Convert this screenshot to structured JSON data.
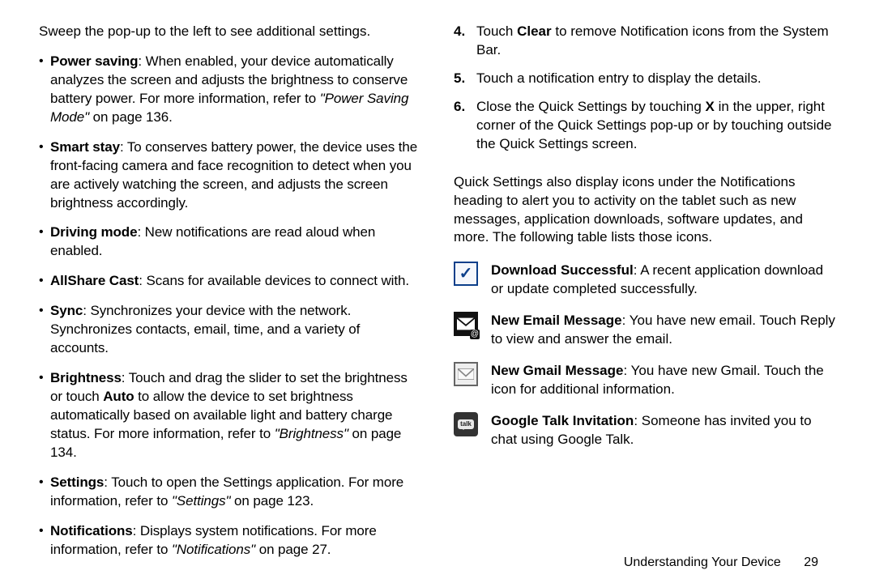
{
  "left": {
    "intro": "Sweep the pop-up to the left to see additional settings.",
    "items": [
      {
        "term": "Power saving",
        "body": ": When enabled, your device automatically analyzes the screen and adjusts the brightness to conserve battery power. For more information, refer to ",
        "ref": "\"Power Saving Mode\"",
        "tail": " on page 136."
      },
      {
        "term": "Smart stay",
        "body": ": To conserves battery power, the device uses the front-facing camera and face recognition to detect when you are actively watching the screen, and adjusts the screen brightness accordingly."
      },
      {
        "term": "Driving mode",
        "body": ": New notifications are read aloud when enabled."
      },
      {
        "term": "AllShare Cast",
        "body": ": Scans for available devices to connect with."
      },
      {
        "term": "Sync",
        "body": ": Synchronizes your device with the network. Synchronizes contacts, email, time, and a variety of accounts."
      },
      {
        "term": "Brightness",
        "body": ": Touch and drag the slider to set the brightness or touch ",
        "bold_mid": "Auto",
        "body2": " to allow the device to set brightness automatically based on available light and battery charge status. For more information, refer to ",
        "ref": "\"Brightness\"",
        "tail": " on page 134."
      },
      {
        "term": "Settings",
        "body": ": Touch to open the Settings application. For more information, refer to ",
        "ref": "\"Settings\"",
        "tail": " on page 123."
      },
      {
        "term": "Notifications",
        "body": ": Displays system notifications. For more information, refer to ",
        "ref": "\"Notifications\"",
        "tail": " on page 27."
      }
    ]
  },
  "right": {
    "steps": [
      {
        "pre": "Touch ",
        "bold": "Clear",
        "post": " to remove Notification icons from the System Bar."
      },
      {
        "pre": "Touch a notification entry to display the details."
      },
      {
        "pre": "Close the Quick Settings by touching ",
        "bold": "X",
        "post": " in the upper, right corner of the Quick Settings pop-up or by touching outside the Quick Settings screen."
      }
    ],
    "para": "Quick Settings also display icons under the Notifications heading to alert you to activity on the tablet such as new messages, application downloads, software updates, and more. The following table lists those icons.",
    "icons": [
      {
        "name": "download-success-icon",
        "term": "Download Successful",
        "desc": ": A recent application download or update completed successfully."
      },
      {
        "name": "new-email-icon",
        "term": "New Email Message",
        "desc": ": You have new email. Touch Reply to view and answer the email."
      },
      {
        "name": "new-gmail-icon",
        "term": "New Gmail Message",
        "desc": ": You have new Gmail. Touch the icon for additional information."
      },
      {
        "name": "google-talk-icon",
        "term": "Google Talk Invitation",
        "desc": ": Someone has invited you to chat using Google Talk."
      }
    ]
  },
  "footer": {
    "section": "Understanding Your Device",
    "page": "29"
  }
}
